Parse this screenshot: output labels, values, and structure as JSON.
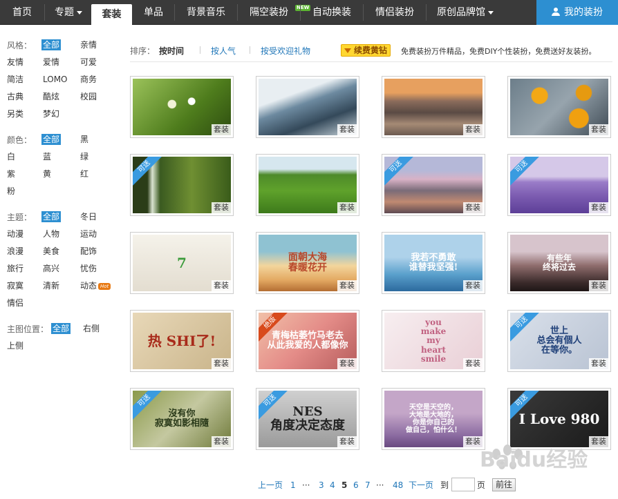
{
  "nav": {
    "home": "首页",
    "topic": "专题",
    "suit": "套装",
    "single": "单品",
    "music": "背景音乐",
    "space": "隔空装扮",
    "auto": "自动换装",
    "couple": "情侣装扮",
    "original": "原创品牌馆",
    "new_badge": "NEW",
    "mine": "我的装扮"
  },
  "filters": {
    "style": {
      "label": "风格：",
      "options": [
        "全部",
        "亲情",
        "友情",
        "爱情",
        "可爱",
        "简洁",
        "LOMO",
        "商务",
        "古典",
        "酷炫",
        "校园",
        "另类",
        "梦幻"
      ]
    },
    "color": {
      "label": "颜色：",
      "options": [
        "全部",
        "黑",
        "白",
        "蓝",
        "绿",
        "紫",
        "黄",
        "红",
        "粉"
      ]
    },
    "theme": {
      "label": "主题：",
      "options": [
        "全部",
        "冬日",
        "动漫",
        "人物",
        "运动",
        "浪漫",
        "美食",
        "配饰",
        "旅行",
        "高兴",
        "忧伤",
        "寂寞",
        "清新",
        "动态",
        "情侣"
      ],
      "hot_badge": "Hot"
    },
    "position": {
      "label": "主图位置：",
      "options": [
        "全部",
        "右侧",
        "上侧"
      ]
    }
  },
  "sort": {
    "label": "排序：",
    "by_time": "按时间",
    "by_popularity": "按人气",
    "by_gift": "按受欢迎礼物",
    "renew_button": "续费黄钻",
    "promo_text": "免费装扮万件精品，免费DIY个性装扮，免费送好友装扮。"
  },
  "cards": [
    {
      "tag": "套装",
      "ribbon": "",
      "text": ""
    },
    {
      "tag": "套装",
      "ribbon": "",
      "text": ""
    },
    {
      "tag": "套装",
      "ribbon": "",
      "text": ""
    },
    {
      "tag": "套装",
      "ribbon": "",
      "text": ""
    },
    {
      "tag": "套装",
      "ribbon": "可送",
      "text": ""
    },
    {
      "tag": "套装",
      "ribbon": "",
      "text": ""
    },
    {
      "tag": "套装",
      "ribbon": "可送",
      "text": ""
    },
    {
      "tag": "套装",
      "ribbon": "可送",
      "text": ""
    },
    {
      "tag": "套装",
      "ribbon": "",
      "text": "7"
    },
    {
      "tag": "套装",
      "ribbon": "",
      "text": "面朝大海\n春暖花开"
    },
    {
      "tag": "套装",
      "ribbon": "",
      "text": "我若不勇敢\n谁替我坚强!"
    },
    {
      "tag": "套装",
      "ribbon": "",
      "text": "有些年\n终将过去"
    },
    {
      "tag": "套装",
      "ribbon": "",
      "text": "热 SHI了!"
    },
    {
      "tag": "套装",
      "ribbon": "绝版",
      "text": "青梅枯萎竹马老去\n从此我爱的人都像你"
    },
    {
      "tag": "套装",
      "ribbon": "",
      "text": "you\nmake\nmy\nheart\nsmile"
    },
    {
      "tag": "套装",
      "ribbon": "可送",
      "text": "世上\n总会有個人\n在等你。"
    },
    {
      "tag": "套装",
      "ribbon": "可送",
      "text": "沒有你\n寂寞如影相隨"
    },
    {
      "tag": "套装",
      "ribbon": "可送",
      "text": "NES\n角度决定态度"
    },
    {
      "tag": "套装",
      "ribbon": "",
      "text": "天空是天空的，\n大地是大地的，\n你是你自己的\n做自己，怕什么！"
    },
    {
      "tag": "套装",
      "ribbon": "可送",
      "text": "I Love 980"
    }
  ],
  "pager": {
    "prev": "上一页",
    "p1": "1",
    "ellipsis1": "···",
    "p3": "3",
    "p4": "4",
    "p5": "5",
    "p6": "6",
    "p7": "7",
    "ellipsis2": "···",
    "p48": "48",
    "next": "下一页",
    "goto_label": "到",
    "page_label": "页",
    "goto_button": "前往"
  },
  "watermark": "Baidu经验"
}
